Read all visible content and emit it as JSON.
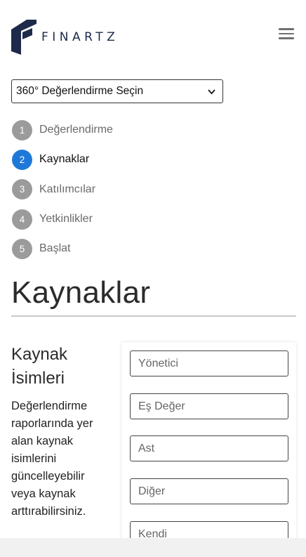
{
  "header": {
    "brand": "FINARTZ",
    "logo_icon": "finartz-logo-icon",
    "menu_icon": "hamburger-menu-icon"
  },
  "evaluation_select": {
    "selected": "360° Değerlendirme Seçin"
  },
  "steps": [
    {
      "number": "1",
      "label": "Değerlendirme",
      "active": false
    },
    {
      "number": "2",
      "label": "Kaynaklar",
      "active": true
    },
    {
      "number": "3",
      "label": "Katılımcılar",
      "active": false
    },
    {
      "number": "4",
      "label": "Yetkinlikler",
      "active": false
    },
    {
      "number": "5",
      "label": "Başlat",
      "active": false
    }
  ],
  "page": {
    "title": "Kaynaklar"
  },
  "source_names": {
    "title": "Kaynak İsimleri",
    "description": "Değerlendirme raporlarında yer alan kaynak isimlerini güncelleyebilir veya kaynak arttırabilirsiniz.",
    "fields": [
      {
        "placeholder": "Yönetici"
      },
      {
        "placeholder": "Eş Değer"
      },
      {
        "placeholder": "Ast"
      },
      {
        "placeholder": "Diğer"
      },
      {
        "placeholder": "Kendi"
      }
    ]
  },
  "colors": {
    "accent": "#1e78d8",
    "brand": "#1d2a4a",
    "step_inactive": "#9b9b9b"
  }
}
